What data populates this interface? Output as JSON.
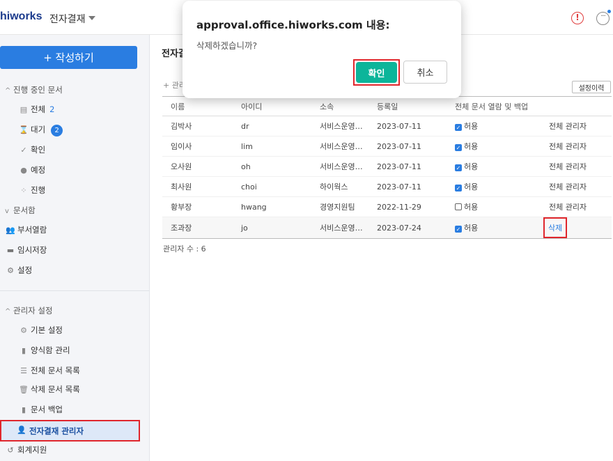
{
  "header": {
    "logo": "hiworks",
    "app_title": "전자결재",
    "alert_icon": "!",
    "more_icon": "···"
  },
  "sidebar": {
    "write_button": "+ 작성하기",
    "in_progress_section": "진행 중인 문서",
    "items": [
      {
        "label": "전체",
        "count": "2",
        "icon": "doc-icon"
      },
      {
        "label": "대기",
        "badge": "2",
        "icon": "hourglass-icon"
      },
      {
        "label": "확인",
        "icon": "check-icon"
      },
      {
        "label": "예정",
        "icon": "clock-icon"
      },
      {
        "label": "진행",
        "icon": "spinner-icon"
      }
    ],
    "docbox_section": "문서함",
    "docbox_items": [
      {
        "label": "부서열람",
        "icon": "people-icon"
      },
      {
        "label": "임시저장",
        "icon": "box-icon"
      },
      {
        "label": "설정",
        "icon": "gear-icon"
      }
    ],
    "admin_section": "관리자 설정",
    "admin_items": [
      {
        "label": "기본 설정",
        "icon": "gear-icon"
      },
      {
        "label": "양식함 관리",
        "icon": "doc-icon"
      },
      {
        "label": "전체 문서 목록",
        "icon": "list-icon"
      },
      {
        "label": "삭제 문서 목록",
        "icon": "trash-icon"
      },
      {
        "label": "문서 백업",
        "icon": "doc-icon"
      },
      {
        "label": "전자결재 관리자",
        "icon": "admin-icon"
      }
    ],
    "accounting": "회계지원"
  },
  "main": {
    "title": "전자결",
    "add_link": "+ 관리",
    "history_button": "설정이력",
    "columns": [
      "이름",
      "아이디",
      "소속",
      "등록일",
      "전체 문서 열람 및 백업",
      ""
    ],
    "rows": [
      {
        "name": "김박사",
        "id": "dr",
        "dept": "서비스운영…",
        "date": "2023-07-11",
        "checked": true,
        "perm": "허용",
        "action": "전체 관리자"
      },
      {
        "name": "임이사",
        "id": "lim",
        "dept": "서비스운영…",
        "date": "2023-07-11",
        "checked": true,
        "perm": "허용",
        "action": "전체 관리자"
      },
      {
        "name": "오사원",
        "id": "oh",
        "dept": "서비스운영…",
        "date": "2023-07-11",
        "checked": true,
        "perm": "허용",
        "action": "전체 관리자"
      },
      {
        "name": "최사원",
        "id": "choi",
        "dept": "하이웍스",
        "date": "2023-07-11",
        "checked": true,
        "perm": "허용",
        "action": "전체 관리자"
      },
      {
        "name": "황부장",
        "id": "hwang",
        "dept": "경영지원팀",
        "date": "2022-11-29",
        "checked": false,
        "perm": "허용",
        "action": "전체 관리자"
      },
      {
        "name": "조과장",
        "id": "jo",
        "dept": "서비스운영…",
        "date": "2023-07-24",
        "checked": true,
        "perm": "허용",
        "action": "삭제"
      }
    ],
    "count_label": "관리자 수 : 6"
  },
  "dialog": {
    "title": "approval.office.hiworks.com 내용:",
    "message": "삭제하겠습니까?",
    "ok_label": "확인",
    "cancel_label": "취소"
  },
  "colors": {
    "accent": "#2a7de1",
    "ok_button": "#0cb59a",
    "highlight": "#e0262c"
  }
}
